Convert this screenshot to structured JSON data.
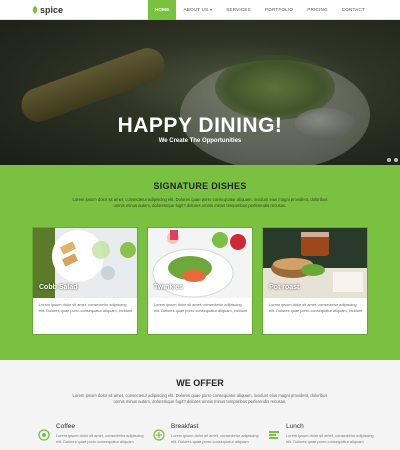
{
  "brand": {
    "name": "spice",
    "color": "#7ac142"
  },
  "nav": {
    "items": [
      {
        "label": "HOME"
      },
      {
        "label": "ABOUT US"
      },
      {
        "label": "SERVICES"
      },
      {
        "label": "PORTFOLIO"
      },
      {
        "label": "PRICING"
      },
      {
        "label": "CONTACT"
      }
    ]
  },
  "hero": {
    "title": "HAPPY DINING!",
    "subtitle": "We Create The Opportunities"
  },
  "signature": {
    "title": "SIGNATURE DISHES",
    "text": "Lorem ipsum dolor sit amet, consectetur adipiscing elit. Dolores quae porro consequatur aliquam, incidunt eius magni provident, doloribus omnis minus autem, doloremque fugit? dolores omnis minus temporibus perferendis recusan.",
    "cards": [
      {
        "name": "Cobb Salad",
        "text": "Lorem ipsum dolor sit amet, consectetur adipiscing elit. Dolores quae porro consequatur aliquam, incidunt"
      },
      {
        "name": "Twinkies",
        "text": "Lorem ipsum dolor sit amet, consectetur adipiscing elit. Dolores quae porro consequatur aliquam, incidunt"
      },
      {
        "name": "Pot roast",
        "text": "Lorem ipsum dolor sit amet, consectetur adipiscing elit. Dolores quae porro consequatur aliquam, incidunt"
      }
    ]
  },
  "offer": {
    "title": "WE OFFER",
    "text": "Lorem ipsum dolor sit amet, consectetur adipiscing elit. Dolores quae porro consequatur aliquam, incidunt eius magni provident, doloribus omnis minus autem, doloremque fugit? dolores omnis minus temporibus perferendis recusan.",
    "services": [
      {
        "name": "Coffee",
        "icon": "coffee-icon",
        "text": "Lorem ipsum dolor sit amet, consectetur adipiscing elit. Dolores quae porro consequatur aliquam"
      },
      {
        "name": "Breakfast",
        "icon": "breakfast-icon",
        "text": "Lorem ipsum dolor sit amet, consectetur adipiscing elit. Dolores quae porro consequatur aliquam"
      },
      {
        "name": "Lunch",
        "icon": "lunch-icon",
        "text": "Lorem ipsum dolor sit amet, consectetur adipiscing elit. Dolores quae porro consequatur aliquam"
      }
    ]
  }
}
